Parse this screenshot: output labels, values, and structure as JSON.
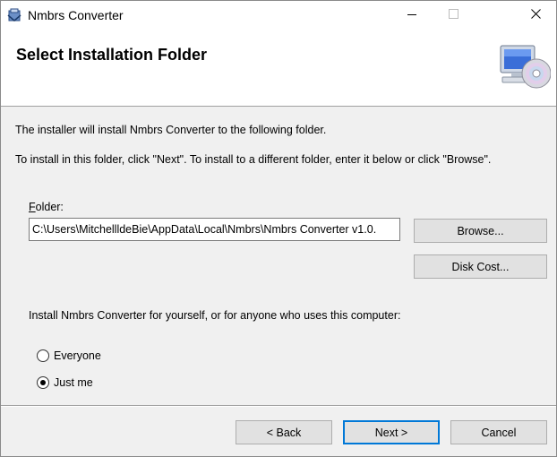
{
  "window": {
    "title": "Nmbrs Converter",
    "minimize_icon": "minimize-icon",
    "maximize_icon": "maximize-icon",
    "close_icon": "close-icon"
  },
  "header": {
    "title": "Select Installation Folder",
    "icon": "computer-cd-icon"
  },
  "body": {
    "description_1": "The installer will install Nmbrs Converter to the following folder.",
    "description_2": "To install in this folder, click \"Next\". To install to a different folder, enter it below or click \"Browse\".",
    "folder_label_accel": "F",
    "folder_label_rest": "older:",
    "folder_value": "C:\\Users\\MitchellldeBie\\AppData\\Local\\Nmbrs\\Nmbrs Converter v1.0.",
    "browse_label": "Browse...",
    "disk_cost_label": "Disk Cost...",
    "scope_label": "Install Nmbrs Converter for yourself, or for anyone who uses this computer:",
    "options": [
      {
        "label": "Everyone",
        "selected": false
      },
      {
        "label": "Just me",
        "selected": true
      }
    ]
  },
  "footer": {
    "back_label": "< Back",
    "next_label": "Next >",
    "cancel_label": "Cancel"
  },
  "colors": {
    "dialog_bg": "#f0f0f0",
    "header_bg": "#ffffff",
    "default_button_border": "#0078d7"
  }
}
